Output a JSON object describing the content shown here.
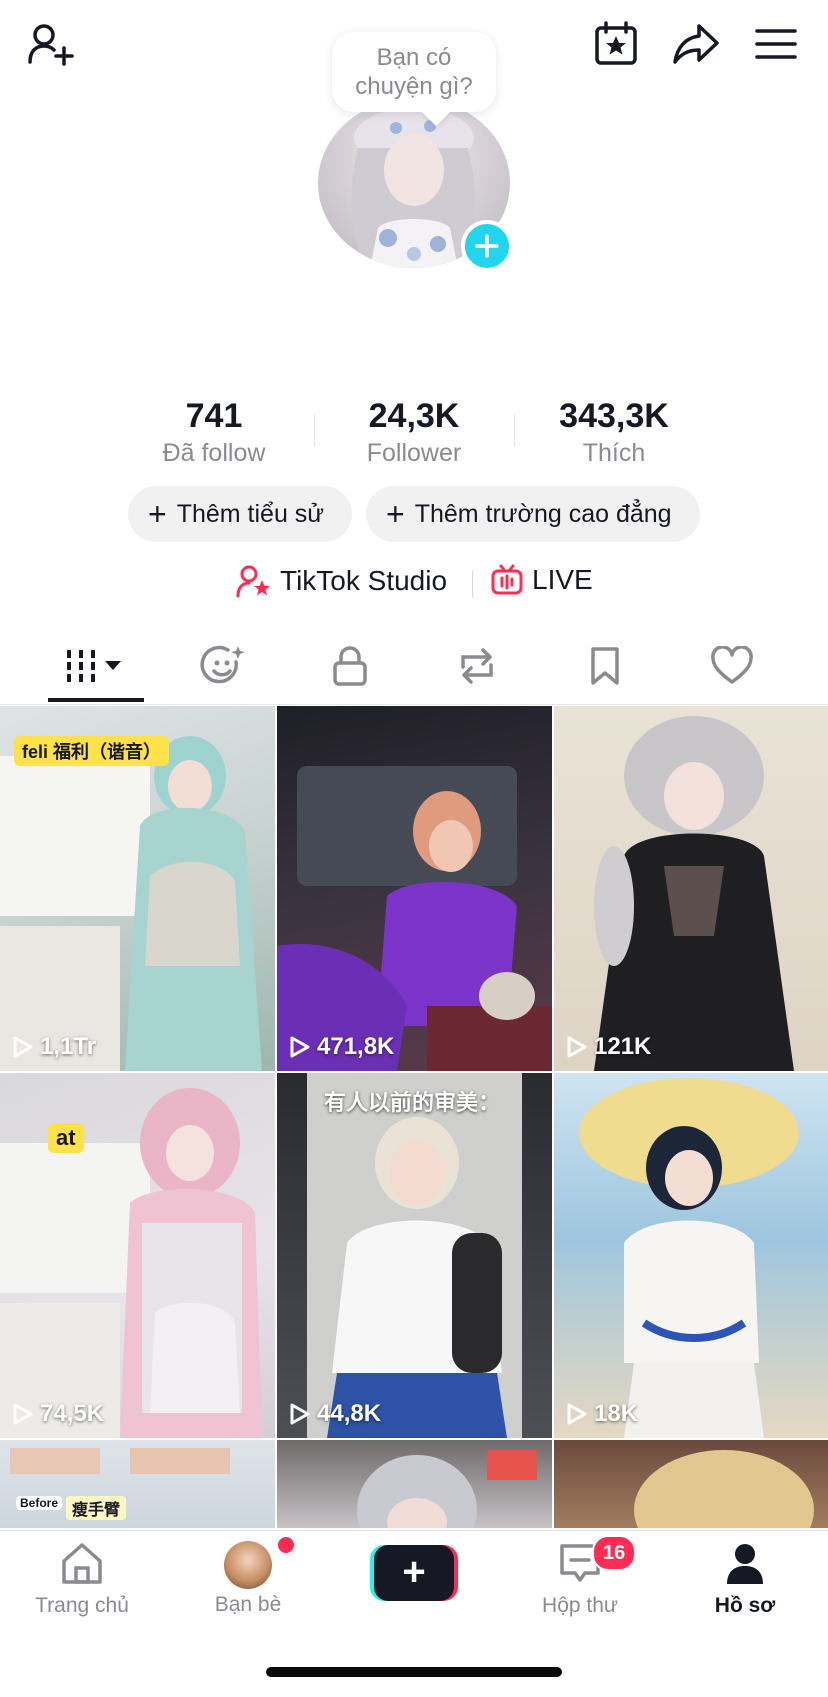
{
  "header": {
    "add_friend_icon": "person-plus-icon",
    "calendar_icon": "calendar-star-icon",
    "share_icon": "share-arrow-icon",
    "menu_icon": "hamburger-menu-icon"
  },
  "profile": {
    "bubble_line1": "Bạn có",
    "bubble_line2": "chuyện gì?"
  },
  "stats": [
    {
      "value": "741",
      "label": "Đã follow"
    },
    {
      "value": "24,3K",
      "label": "Follower"
    },
    {
      "value": "343,3K",
      "label": "Thích"
    }
  ],
  "pills": {
    "bio_plus": "+",
    "bio": "Thêm tiểu sử",
    "school_plus": "+",
    "school": "Thêm trường cao đẳng"
  },
  "links": {
    "studio": "TikTok Studio",
    "live": "LIVE"
  },
  "tabs": [
    "videos-grid-icon",
    "reposts-smile-icon",
    "private-lock-icon",
    "repost-arrows-icon",
    "bookmark-icon",
    "heart-icon"
  ],
  "videos": [
    {
      "views": "1,1Tr",
      "caption": "feli 福利（谐音）"
    },
    {
      "views": "471,8K",
      "caption": ""
    },
    {
      "views": "121K",
      "caption": ""
    },
    {
      "views": "74,5K",
      "caption": "at"
    },
    {
      "views": "44,8K",
      "caption": "有人以前的审美："
    },
    {
      "views": "18K",
      "caption": ""
    }
  ],
  "partial_captions": {
    "row3_a": "瘦手臂",
    "row3_b": "Before"
  },
  "bottom_nav": {
    "home": "Trang chủ",
    "friends": "Bạn bè",
    "create": "+",
    "inbox": "Hộp thư",
    "inbox_badge": "16",
    "profile": "Hồ sơ"
  },
  "colors": {
    "accent_cyan": "#20d5ec",
    "accent_red": "#fe2c55",
    "text": "#161823",
    "muted": "#8a8b91"
  }
}
